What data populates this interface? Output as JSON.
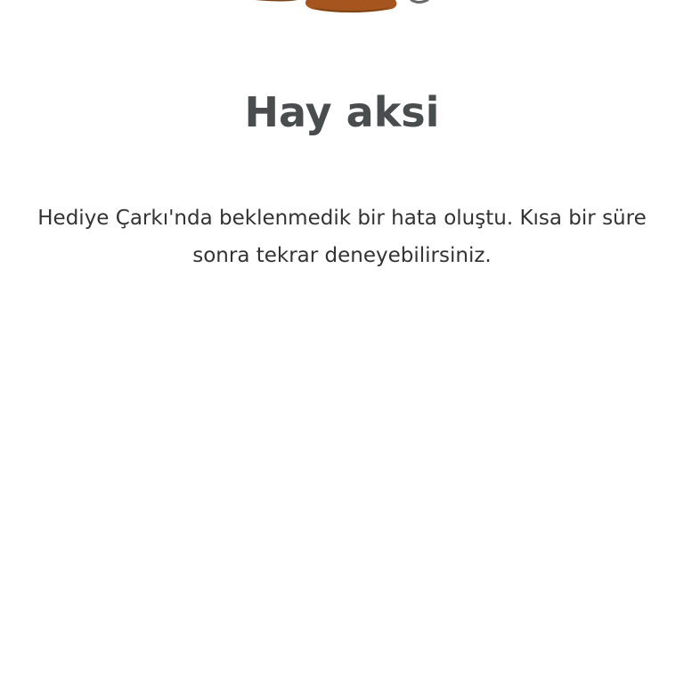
{
  "title": "Hay aksi",
  "message": "Hediye Çarkı'nda beklenmedik bir hata oluştu. Kısa bir süre sonra tekrar deneyebilirsiniz.",
  "illustration": {
    "icon": "error-illustration",
    "colors": {
      "dark_brown": "#7a4416",
      "brown": "#a5551d",
      "grey": "#6a6a6a"
    }
  }
}
